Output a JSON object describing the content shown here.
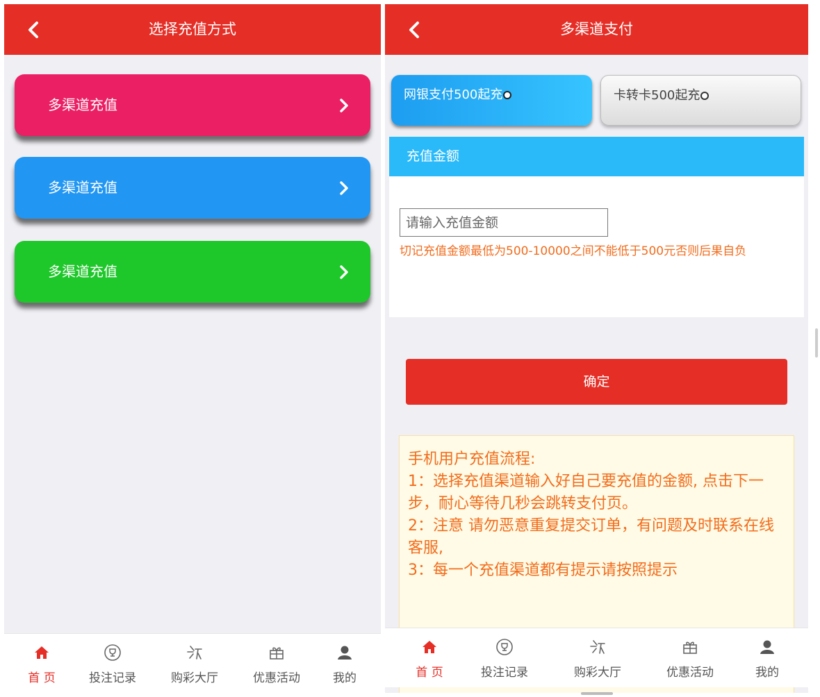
{
  "left": {
    "title": "选择充值方式",
    "channels": [
      {
        "label": "多渠道充值",
        "color": "#eb1f63"
      },
      {
        "label": "多渠道充值",
        "color": "#2196f3"
      },
      {
        "label": "多渠道充值",
        "color": "#1ec72a"
      }
    ]
  },
  "right": {
    "title": "多渠道支付",
    "pay_tabs": [
      {
        "label": "网银支付500起充",
        "selected": true
      },
      {
        "label": "卡转卡500起充",
        "selected": false
      }
    ],
    "amount_title": "充值金额",
    "amount_placeholder": "请输入充值金额",
    "amount_note": "切记充值金额最低为500-10000之间不能低于500元否则后果自负",
    "confirm_label": "确定",
    "notice_lines": [
      "手机用户充值流程:",
      "1：选择充值渠道输入好自己要充值的金额, 点击下一步，耐心等待几秒会跳转支付页。",
      "2：注意 请勿恶意重复提交订单，有问题及时联系在线客服,",
      "3：每一个充值渠道都有提示请按照提示"
    ]
  },
  "tabbar": {
    "items": [
      {
        "label": "首 页",
        "icon": "home-icon",
        "active": true
      },
      {
        "label": "投注记录",
        "icon": "trophy-icon",
        "active": false
      },
      {
        "label": "购彩大厅",
        "icon": "lottery-star-icon",
        "active": false
      },
      {
        "label": "优惠活动",
        "icon": "gift-icon",
        "active": false
      },
      {
        "label": "我的",
        "icon": "user-icon",
        "active": false
      }
    ]
  },
  "colors": {
    "header_red": "#e52e26",
    "accent_blue": "#2bbaf9",
    "note_orange": "#f26c1c",
    "notice_bg": "#fffbe6"
  }
}
